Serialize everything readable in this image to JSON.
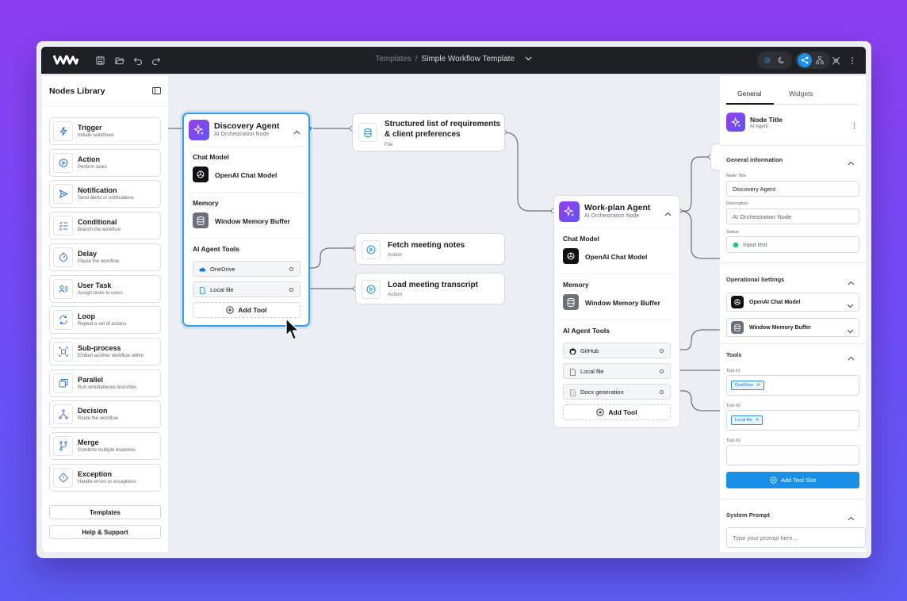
{
  "topbar": {
    "breadcrumb_parent": "Templates",
    "breadcrumb_separator": "/",
    "breadcrumb_current": "Simple Workflow Template"
  },
  "nodes_library": {
    "title": "Nodes Library",
    "items": [
      {
        "name": "Trigger",
        "desc": "Initiate workflows",
        "icon": "lightning-icon"
      },
      {
        "name": "Action",
        "desc": "Perform tasks",
        "icon": "play-icon"
      },
      {
        "name": "Notification",
        "desc": "Send alerts or notifications",
        "icon": "send-icon"
      },
      {
        "name": "Conditional",
        "desc": "Branch the workflow",
        "icon": "checklist-icon"
      },
      {
        "name": "Delay",
        "desc": "Pause the workflow",
        "icon": "timer-icon"
      },
      {
        "name": "User Task",
        "desc": "Assign tasks to users",
        "icon": "user-task-icon"
      },
      {
        "name": "Loop",
        "desc": "Repeat a set of actions",
        "icon": "loop-icon"
      },
      {
        "name": "Sub-process",
        "desc": "Embed another workflow within",
        "icon": "subprocess-icon"
      },
      {
        "name": "Parallel",
        "desc": "Run simultaneous branches",
        "icon": "parallel-icon"
      },
      {
        "name": "Decision",
        "desc": "Route the workflow",
        "icon": "decision-icon"
      },
      {
        "name": "Merge",
        "desc": "Combine multiple branches",
        "icon": "merge-icon"
      },
      {
        "name": "Exception",
        "desc": "Handle errors or exceptions",
        "icon": "exception-icon"
      }
    ],
    "templates_label": "Templates",
    "help_label": "Help & Support"
  },
  "discovery_agent": {
    "title": "Discovery Agent",
    "subtitle": "AI Orchestration Node",
    "chat_model_heading": "Chat Model",
    "chat_model": "OpenAI Chat Model",
    "memory_heading": "Memory",
    "memory": "Window Memory Buffer",
    "tools_heading": "AI Agent Tools",
    "tools": [
      "OneDrive",
      "Local file"
    ],
    "add_tool": "Add Tool"
  },
  "structured_node": {
    "title_line1": "Structured list of requirements",
    "title_line2": "& client preferences",
    "subtitle": "File"
  },
  "fetch_node": {
    "title": "Fetch meeting notes",
    "subtitle": "Action"
  },
  "load_node": {
    "title": "Load meeting transcript",
    "subtitle": "Action"
  },
  "workplan_agent": {
    "title": "Work-plan Agent",
    "subtitle": "AI Orchestration Node",
    "chat_model_heading": "Chat Model",
    "chat_model": "OpenAI Chat Model",
    "memory_heading": "Memory",
    "memory": "Window Memory Buffer",
    "tools_heading": "AI Agent Tools",
    "tools": [
      "GitHub",
      "Local file",
      "Docx generation"
    ],
    "add_tool": "Add Tool"
  },
  "properties": {
    "tabs": [
      "General",
      "Widgets"
    ],
    "node_title": "Node Title",
    "node_subtitle": "AI Agent",
    "general_info_heading": "General information",
    "node_title_label": "Node Title",
    "node_title_value": "Discovery Agent",
    "description_label": "Description",
    "description_value": "AI Orchestration Node",
    "status_label": "Status",
    "status_value": "Input text",
    "operational_heading": "Operational Settings",
    "chat_model": "OpenAI Chat Model",
    "memory": "Window Memory Buffer",
    "tools_heading": "Tools",
    "tool1_label": "Tool #1",
    "tool1_chip": "OneDrive",
    "tool2_label": "Tool #2",
    "tool2_chip": "Local file",
    "tool3_label": "Tool #3",
    "add_slot": "Add Tool Slot",
    "system_prompt_heading": "System Prompt",
    "system_prompt_placeholder": "Type your prompt here..."
  },
  "colors": {
    "accent": "#1a8fe8",
    "agent_gradient_start": "#9a3ef0",
    "agent_gradient_end": "#5b55f2",
    "background_start": "#8c3ef0",
    "background_end": "#5b5cf2"
  }
}
